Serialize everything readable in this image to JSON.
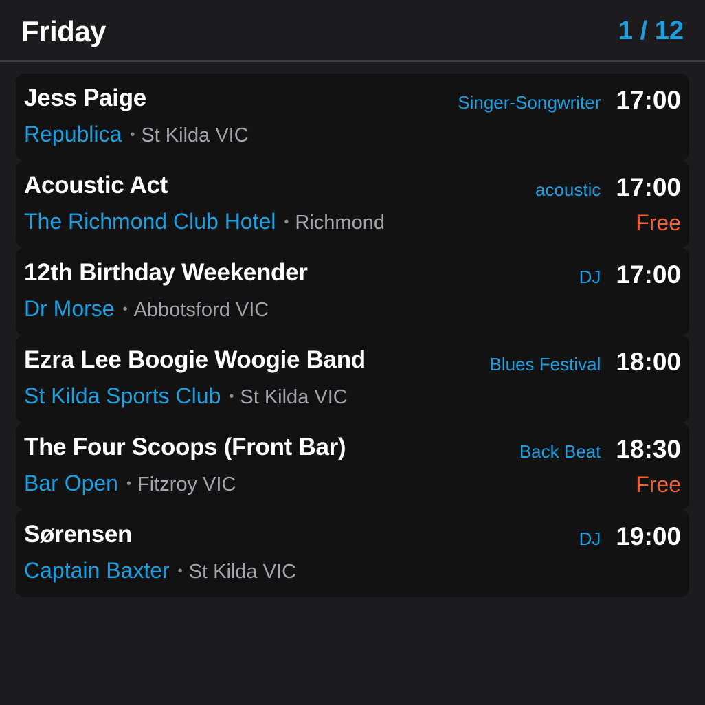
{
  "header": {
    "title": "Friday",
    "page": "1 / 12"
  },
  "events": [
    {
      "title": "Jess Paige",
      "genre": "Singer-Songwriter",
      "time": "17:00",
      "venue": "Republica",
      "separator": "•",
      "location": "St Kilda VIC",
      "price": ""
    },
    {
      "title": "Acoustic Act",
      "genre": "acoustic",
      "time": "17:00",
      "venue": "The Richmond Club Hotel",
      "separator": "•",
      "location": "Richmond",
      "price": "Free"
    },
    {
      "title": "12th Birthday Weekender",
      "genre": "DJ",
      "time": "17:00",
      "venue": "Dr Morse",
      "separator": "•",
      "location": "Abbotsford VIC",
      "price": ""
    },
    {
      "title": "Ezra Lee Boogie Woogie Band",
      "genre": "Blues Festival",
      "time": "18:00",
      "venue": "St Kilda Sports Club",
      "separator": "•",
      "location": "St Kilda VIC",
      "price": ""
    },
    {
      "title": "The Four Scoops (Front Bar)",
      "genre": "Back Beat",
      "time": "18:30",
      "venue": "Bar Open",
      "separator": "•",
      "location": "Fitzroy VIC",
      "price": "Free"
    },
    {
      "title": "Sørensen",
      "genre": "DJ",
      "time": "19:00",
      "venue": "Captain Baxter",
      "separator": "•",
      "location": "St Kilda VIC",
      "price": ""
    }
  ],
  "colors": {
    "background": "#1c1c1e",
    "card": "#121212",
    "accent": "#1a9fe0",
    "price": "#f0603b",
    "secondary_text": "#a3a3aa"
  }
}
